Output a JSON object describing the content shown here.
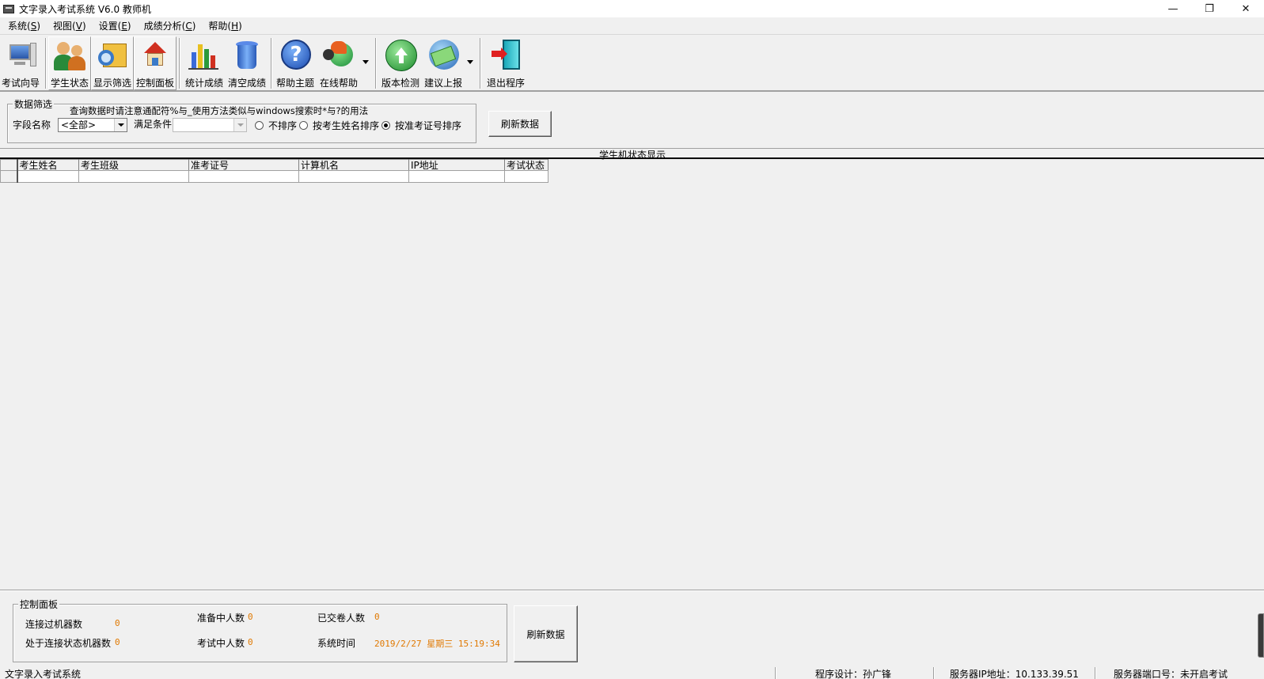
{
  "window": {
    "title": "文字录入考试系统 V6.0 教师机",
    "minimize": "—",
    "restore": "❐",
    "close": "✕"
  },
  "menu": [
    {
      "label": "系统",
      "key": "S"
    },
    {
      "label": "视图",
      "key": "V"
    },
    {
      "label": "设置",
      "key": "E"
    },
    {
      "label": "成绩分析",
      "key": "C"
    },
    {
      "label": "帮助",
      "key": "H"
    }
  ],
  "toolbar": {
    "exam_wizard": "考试向导",
    "student_status": "学生状态",
    "show_filter": "显示筛选",
    "control_panel": "控制面板",
    "stat_scores": "统计成绩",
    "clear_scores": "清空成绩",
    "help_topics": "帮助主题",
    "online_help": "在线帮助",
    "version_check": "版本检测",
    "suggestion": "建议上报",
    "exit": "退出程序"
  },
  "filter": {
    "group_title": "数据筛选",
    "hint": "查询数据时请注意通配符%与_使用方法类似与windows搜索时*与?的用法",
    "field_label": "字段名称",
    "field_value": "<全部>",
    "condition_label": "满足条件",
    "condition_value": "",
    "sort_none": "不排序",
    "sort_name": "按考生姓名排序",
    "sort_id": "按准考证号排序",
    "sort_selected": "sort_id",
    "refresh": "刷新数据"
  },
  "grid": {
    "title": "学生机状态显示",
    "columns": [
      "考生姓名",
      "考生班级",
      "准考证号",
      "计算机名",
      "IP地址",
      "考试状态"
    ],
    "rows": []
  },
  "panel": {
    "title": "控制面板",
    "connected_label": "连接过机器数",
    "connected_value": "0",
    "connecting_label": "处于连接状态机器数",
    "connecting_value": "0",
    "ready_label": "准备中人数",
    "ready_value": "0",
    "testing_label": "考试中人数",
    "testing_value": "0",
    "submitted_label": "已交卷人数",
    "submitted_value": "0",
    "time_label": "系统时间",
    "time_value": "2019/2/27 星期三 15:19:34",
    "refresh": "刷新数据",
    "value_color": "#e07800"
  },
  "status": {
    "app": "文字录入考试系统",
    "designer": "程序设计：孙广锋",
    "server_ip": "服务器IP地址：10.133.39.51",
    "server_port": "服务器端口号：未开启考试"
  }
}
